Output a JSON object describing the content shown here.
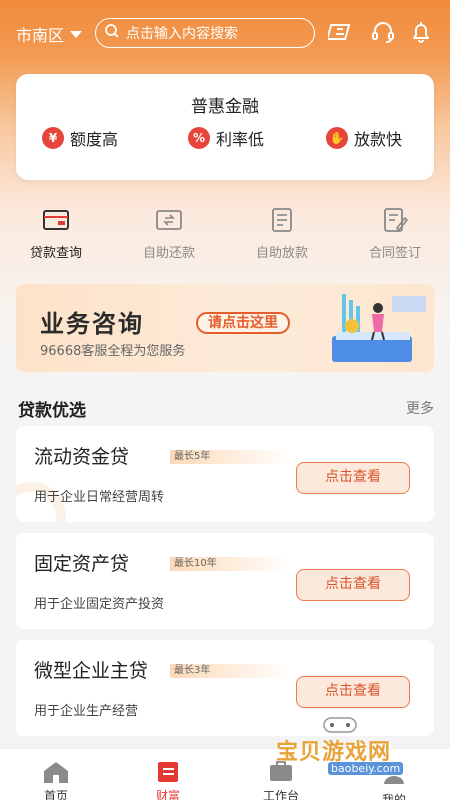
{
  "header": {
    "city": "市南区",
    "search_placeholder": "点击输入内容搜索"
  },
  "promo": {
    "title": "普惠金融",
    "features": [
      {
        "icon": "money-bag-icon",
        "label": "额度高"
      },
      {
        "icon": "percent-icon",
        "label": "利率低"
      },
      {
        "icon": "hand-coin-icon",
        "label": "放款快"
      }
    ]
  },
  "quick_actions": [
    {
      "icon": "card-icon",
      "label": "贷款查询"
    },
    {
      "icon": "card-return-icon",
      "label": "自助还款"
    },
    {
      "icon": "document-icon",
      "label": "自助放款"
    },
    {
      "icon": "contract-sign-icon",
      "label": "合同签订"
    }
  ],
  "banner": {
    "title": "业务咨询",
    "button": "请点击这里",
    "subtitle": "96668客服全程为您服务"
  },
  "loans_section": {
    "title": "贷款优选",
    "more": "更多",
    "items": [
      {
        "name": "流动资金贷",
        "tag": "最长5年",
        "desc": "用于企业日常经营周转",
        "button": "点击查看"
      },
      {
        "name": "固定资产贷",
        "tag": "最长10年",
        "desc": "用于企业固定资产投资",
        "button": "点击查看"
      },
      {
        "name": "微型企业主贷",
        "tag": "最长3年",
        "desc": "用于企业生产经营",
        "button": "点击查看"
      }
    ]
  },
  "nav": [
    {
      "icon": "home-icon",
      "label": "首页"
    },
    {
      "icon": "wealth-icon",
      "label": "财富"
    },
    {
      "icon": "workbench-icon",
      "label": "工作台"
    },
    {
      "icon": "user-icon",
      "label": "我的"
    }
  ],
  "watermark": {
    "text": "宝贝游戏网",
    "url": "baobeiy.com"
  },
  "colors": {
    "accent": "#e23a33",
    "header_orange": "#f08a3a",
    "button_border": "#e67d4a"
  }
}
